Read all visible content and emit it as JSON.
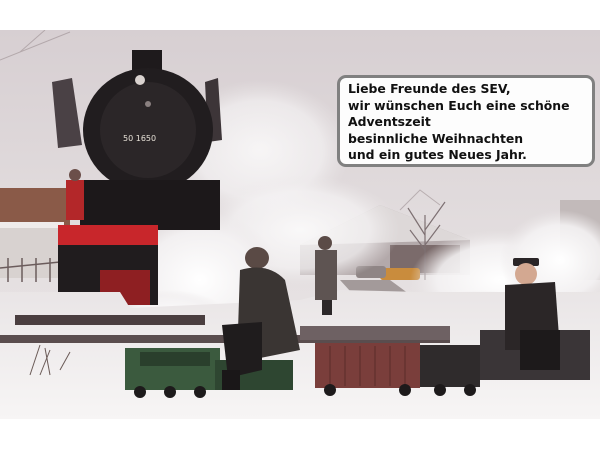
{
  "greeting": {
    "lines": [
      "Liebe Freunde des SEV,",
      "wir wünschen Euch eine schöne",
      "Adventszeit",
      "besinnliche Weihnachten",
      "und ein gutes Neues Jahr."
    ]
  },
  "locomotive": {
    "number": "50 1650"
  },
  "colors": {
    "background": "#ffffff",
    "box_border": "#808080",
    "loco_red": "#c8262b",
    "snow": "#f1eeec"
  }
}
